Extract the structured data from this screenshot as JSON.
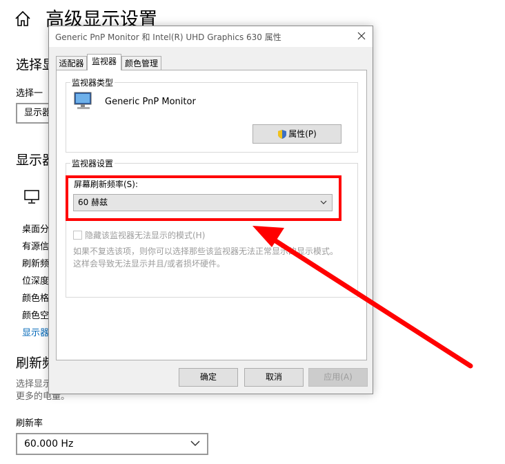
{
  "background_page": {
    "title": "高级显示设置",
    "section1_heading": "选择显",
    "section1_label": "选择一",
    "select_partial_value": "显示器",
    "section2_heading": "显示器",
    "info_rows": [
      "桌面分",
      "有源信",
      "刷新频",
      "位深度",
      "颜色格",
      "颜色空"
    ],
    "adapter_link": "显示器",
    "section3_heading": "刷新频",
    "section3_desc_line1": "选择显示",
    "section3_desc_line2": "更多的电量。",
    "rate_label": "刷新率",
    "rate_value": "60.000 Hz"
  },
  "dialog": {
    "title": "Generic PnP Monitor 和 Intel(R) UHD Graphics 630 属性",
    "tabs": [
      {
        "label": "适配器",
        "active": false
      },
      {
        "label": "监视器",
        "active": true
      },
      {
        "label": "颜色管理",
        "active": false
      }
    ],
    "monitor_type_group": "监视器类型",
    "monitor_name": "Generic PnP Monitor",
    "properties_button": "属性(P)",
    "monitor_settings_group": "监视器设置",
    "refresh_rate_label": "屏幕刷新频率(S):",
    "refresh_rate_value": "60 赫兹",
    "hide_modes_checkbox": "隐藏该监视器无法显示的模式(H)",
    "hint_line1": "如果不复选该项，则你可以选择那些该监视器无法正常显示的显示模式。",
    "hint_line2": "这样会导致无法显示并且/或者损坏硬件。",
    "ok_button": "确定",
    "cancel_button": "取消",
    "apply_button": "应用(A)"
  },
  "annotation": {
    "highlight_color": "#ff0000",
    "arrow_color": "#ff0000"
  },
  "icons": [
    "home-icon",
    "monitor-icon",
    "close-icon",
    "shield-icon",
    "chevron-down-icon"
  ]
}
